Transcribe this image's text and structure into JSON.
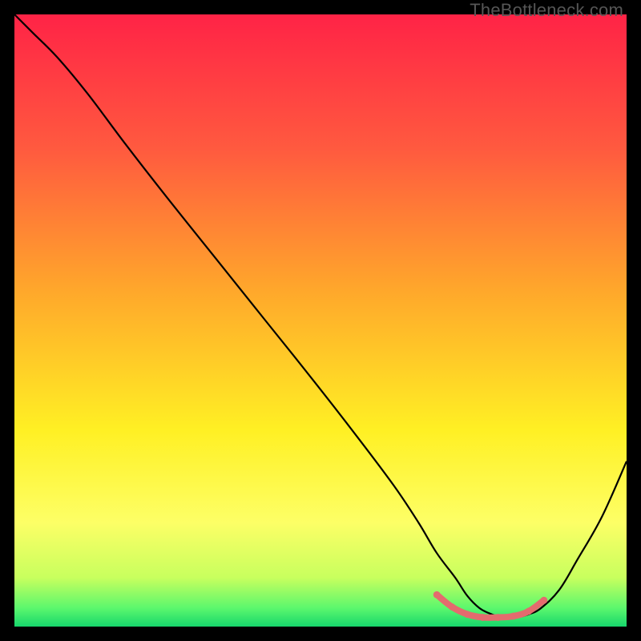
{
  "watermark": "TheBottleneck.com",
  "chart_data": {
    "type": "line",
    "title": "",
    "xlabel": "",
    "ylabel": "",
    "xlim": [
      0,
      100
    ],
    "ylim": [
      0,
      100
    ],
    "grid": false,
    "legend": false,
    "background_gradient_stops": [
      {
        "offset": 0.0,
        "color": "#ff2346"
      },
      {
        "offset": 0.22,
        "color": "#ff5a3f"
      },
      {
        "offset": 0.45,
        "color": "#ffa72b"
      },
      {
        "offset": 0.68,
        "color": "#fff024"
      },
      {
        "offset": 0.83,
        "color": "#fdff66"
      },
      {
        "offset": 0.92,
        "color": "#c8ff5e"
      },
      {
        "offset": 0.97,
        "color": "#5bf76d"
      },
      {
        "offset": 1.0,
        "color": "#16d66c"
      }
    ],
    "series": [
      {
        "name": "bottleneck-curve",
        "color": "#000000",
        "width": 2.2,
        "x": [
          0,
          3,
          7,
          12,
          18,
          25,
          33,
          41,
          49,
          56,
          62,
          66,
          69,
          72,
          74,
          76,
          78,
          80,
          82,
          84,
          86,
          89,
          92,
          96,
          100
        ],
        "y": [
          100,
          97,
          93,
          87,
          79,
          70,
          60,
          50,
          40,
          31,
          23,
          17,
          12,
          8,
          5,
          3,
          2,
          1.5,
          1.5,
          2,
          3,
          6,
          11,
          18,
          27
        ]
      },
      {
        "name": "optimal-band",
        "color": "#e46b6e",
        "width": 8,
        "linecap": "round",
        "x": [
          69,
          71.5,
          74,
          76.5,
          79,
          81.5,
          84,
          86.5
        ],
        "y": [
          5.2,
          3.2,
          2.0,
          1.5,
          1.5,
          1.7,
          2.5,
          4.3
        ]
      }
    ]
  }
}
